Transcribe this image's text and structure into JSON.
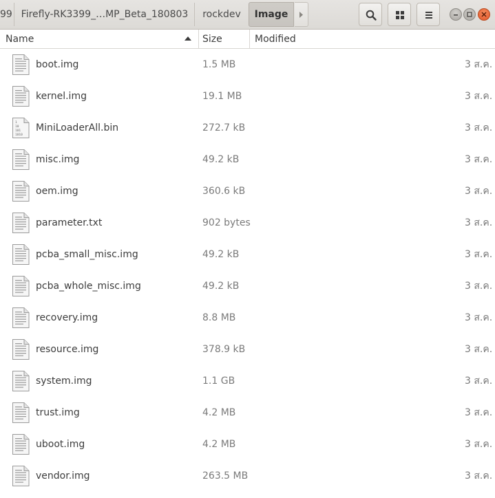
{
  "breadcrumb": {
    "items": [
      {
        "label": "99"
      },
      {
        "label": "Firefly-RK3399_…MP_Beta_180803"
      },
      {
        "label": "rockdev"
      },
      {
        "label": "Image"
      }
    ]
  },
  "toolbar": {
    "search_icon": "search-icon",
    "view_icon": "grid-view-icon",
    "menu_icon": "hamburger-menu-icon"
  },
  "columns": {
    "name": "Name",
    "size": "Size",
    "modified": "Modified"
  },
  "files": [
    {
      "name": "boot.img",
      "size": "1.5 MB",
      "modified": "3 ส.ค.",
      "icon": "text-file-icon"
    },
    {
      "name": "kernel.img",
      "size": "19.1 MB",
      "modified": "3 ส.ค.",
      "icon": "text-file-icon"
    },
    {
      "name": "MiniLoaderAll.bin",
      "size": "272.7 kB",
      "modified": "3 ส.ค.",
      "icon": "binary-file-icon"
    },
    {
      "name": "misc.img",
      "size": "49.2 kB",
      "modified": "3 ส.ค.",
      "icon": "text-file-icon"
    },
    {
      "name": "oem.img",
      "size": "360.6 kB",
      "modified": "3 ส.ค.",
      "icon": "text-file-icon"
    },
    {
      "name": "parameter.txt",
      "size": "902 bytes",
      "modified": "3 ส.ค.",
      "icon": "text-file-icon"
    },
    {
      "name": "pcba_small_misc.img",
      "size": "49.2 kB",
      "modified": "3 ส.ค.",
      "icon": "text-file-icon"
    },
    {
      "name": "pcba_whole_misc.img",
      "size": "49.2 kB",
      "modified": "3 ส.ค.",
      "icon": "text-file-icon"
    },
    {
      "name": "recovery.img",
      "size": "8.8 MB",
      "modified": "3 ส.ค.",
      "icon": "text-file-icon"
    },
    {
      "name": "resource.img",
      "size": "378.9 kB",
      "modified": "3 ส.ค.",
      "icon": "text-file-icon"
    },
    {
      "name": "system.img",
      "size": "1.1 GB",
      "modified": "3 ส.ค.",
      "icon": "text-file-icon"
    },
    {
      "name": "trust.img",
      "size": "4.2 MB",
      "modified": "3 ส.ค.",
      "icon": "text-file-icon"
    },
    {
      "name": "uboot.img",
      "size": "4.2 MB",
      "modified": "3 ส.ค.",
      "icon": "text-file-icon"
    },
    {
      "name": "vendor.img",
      "size": "263.5 MB",
      "modified": "3 ส.ค.",
      "icon": "text-file-icon"
    }
  ],
  "colors": {
    "header_bg": "#dcdad6",
    "close_button": "#e2562a",
    "text": "#3c3c3c",
    "secondary_text": "#7a7a7a"
  }
}
